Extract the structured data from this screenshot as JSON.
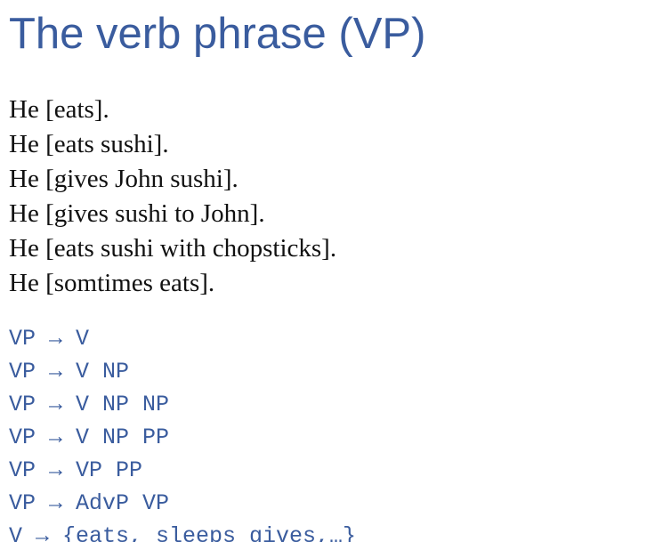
{
  "slide": {
    "title": "The verb phrase (VP)",
    "examples": [
      "He [eats].",
      "He [eats sushi].",
      "He [gives John sushi].",
      "He [gives sushi to John].",
      "He [eats sushi with chopsticks].",
      "He [somtimes eats]."
    ],
    "rules": [
      "VP → V",
      "VP → V NP",
      "VP → V NP NP",
      "VP → V NP PP",
      "VP → VP PP",
      "VP → AdvP VP",
      "V → {eats, sleeps gives,…}"
    ]
  },
  "colors": {
    "accent": "#3a5c9e",
    "text": "#111111",
    "background": "#ffffff"
  }
}
